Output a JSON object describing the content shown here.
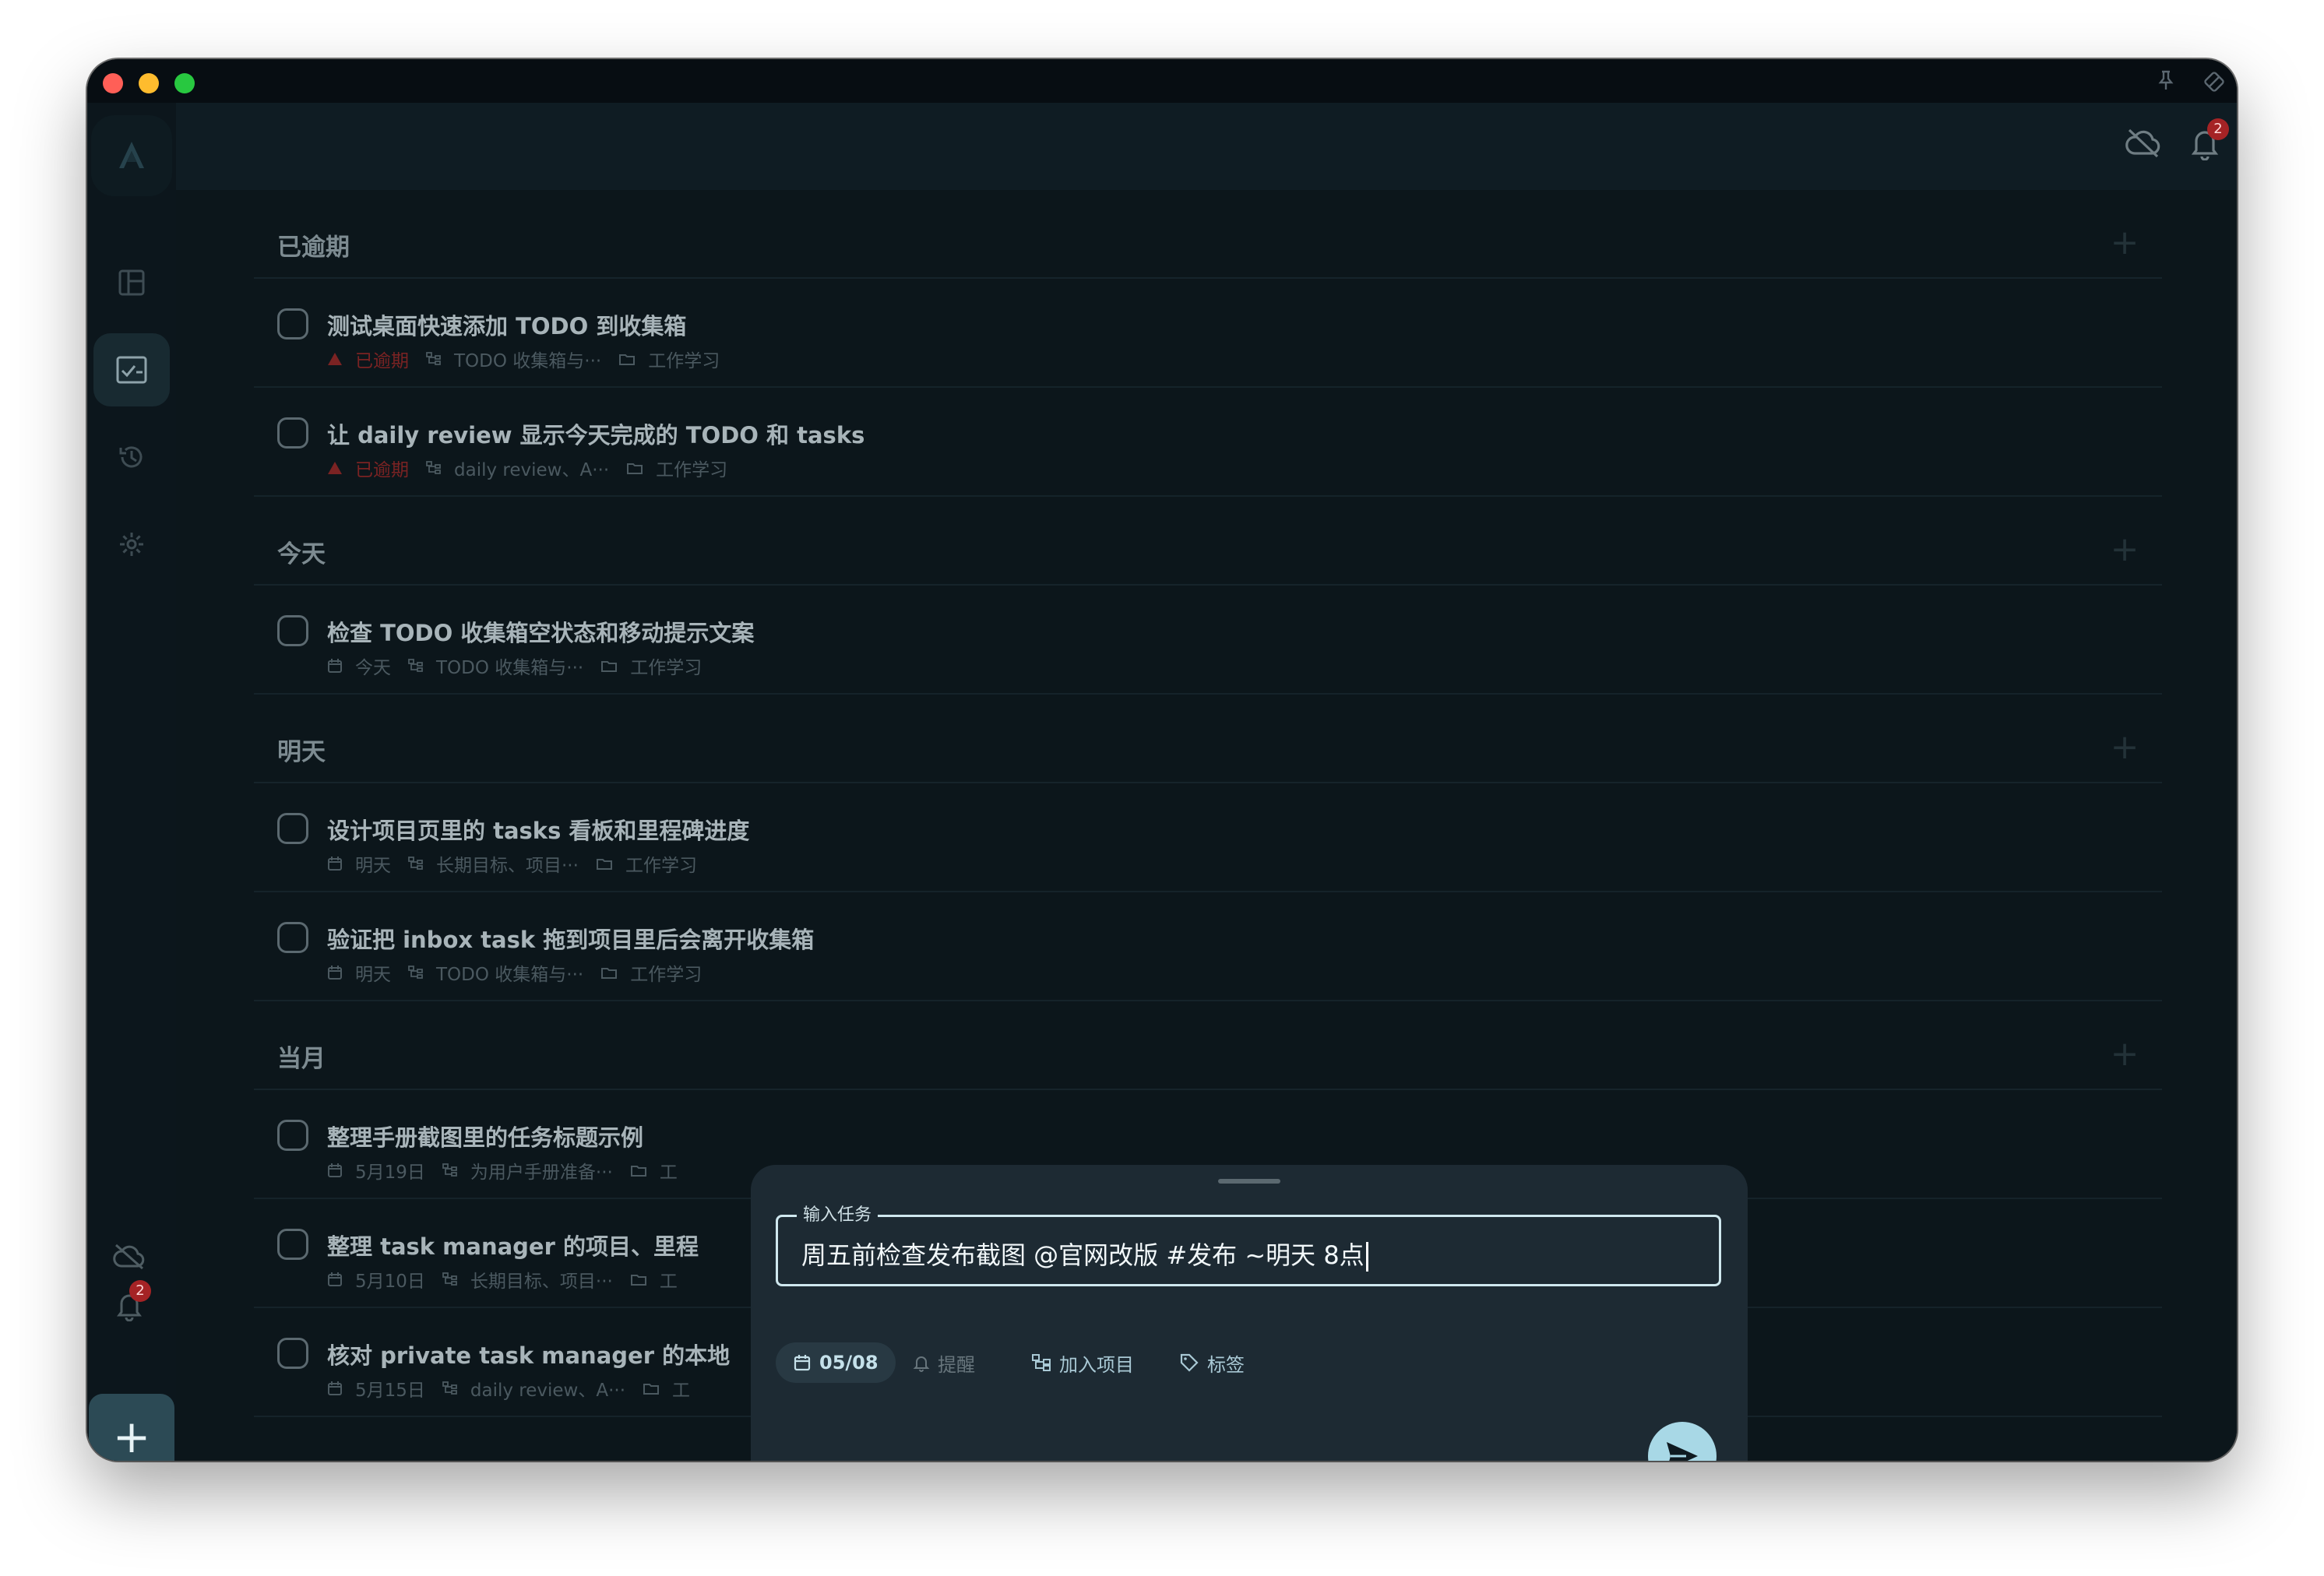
{
  "window": {
    "traffic_lights": [
      "close",
      "minimize",
      "zoom"
    ]
  },
  "sidebar": {
    "logo_icon": "app-logo-icon",
    "items": [
      {
        "name": "dashboard",
        "icon": "layout-icon",
        "active": false
      },
      {
        "name": "tasks",
        "icon": "task-check-icon",
        "active": true
      },
      {
        "name": "history",
        "icon": "history-icon",
        "active": false
      },
      {
        "name": "settings",
        "icon": "gear-icon",
        "active": false
      }
    ],
    "notification_badge": "2",
    "add_label": "+"
  },
  "topbar": {
    "notification_badge": "2"
  },
  "sections": [
    {
      "title": "已逾期",
      "add_label": "+",
      "tasks": [
        {
          "title": "测试桌面快速添加 TODO 到收集箱",
          "date": "已逾期",
          "overdue": true,
          "project": "TODO 收集箱与···",
          "area": "工作学习"
        },
        {
          "title": "让 daily review 显示今天完成的 TODO 和 tasks",
          "date": "已逾期",
          "overdue": true,
          "project": "daily review、A···",
          "area": "工作学习"
        }
      ]
    },
    {
      "title": "今天",
      "add_label": "+",
      "tasks": [
        {
          "title": "检查 TODO 收集箱空状态和移动提示文案",
          "date": "今天",
          "overdue": false,
          "project": "TODO 收集箱与···",
          "area": "工作学习"
        }
      ]
    },
    {
      "title": "明天",
      "add_label": "+",
      "tasks": [
        {
          "title": "设计项目页里的 tasks 看板和里程碑进度",
          "date": "明天",
          "overdue": false,
          "project": "长期目标、项目···",
          "area": "工作学习"
        },
        {
          "title": "验证把 inbox task 拖到项目里后会离开收集箱",
          "date": "明天",
          "overdue": false,
          "project": "TODO 收集箱与···",
          "area": "工作学习"
        }
      ]
    },
    {
      "title": "当月",
      "add_label": "+",
      "tasks": [
        {
          "title": "整理手册截图里的任务标题示例",
          "date": "5月19日",
          "overdue": false,
          "project": "为用户手册准备···",
          "area": "工"
        },
        {
          "title": "整理 task manager 的项目、里程",
          "date": "5月10日",
          "overdue": false,
          "project": "长期目标、项目···",
          "area": "工"
        },
        {
          "title": "核对 private task manager 的本地",
          "date": "5月15日",
          "overdue": false,
          "project": "daily review、A···",
          "area": "工"
        }
      ]
    }
  ],
  "quick_add": {
    "label": "输入任务",
    "value": "周五前检查发布截图 @官网改版 #发布 ~明天 8点",
    "date_chip": "05/08",
    "reminder_chip": "提醒",
    "project_chip": "加入项目",
    "tag_chip": "标签"
  },
  "colors": {
    "accent": "#a8d8e6",
    "overdue": "#a52325",
    "background": "#0c161b",
    "sheet": "#1d2a33"
  }
}
